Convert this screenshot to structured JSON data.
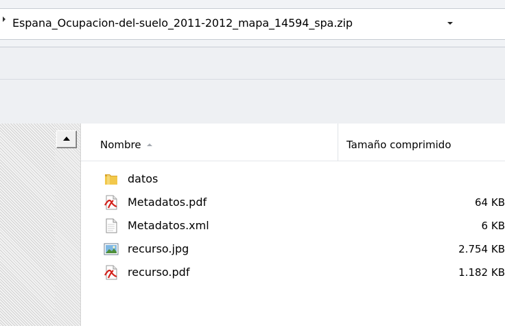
{
  "address": {
    "path_label": "Espana_Ocupacion-del-suelo_2011-2012_mapa_14594_spa.zip"
  },
  "columns": {
    "name": "Nombre",
    "size": "Tamaño comprimido"
  },
  "files": [
    {
      "name": "datos",
      "size": "",
      "icon": "folder-icon"
    },
    {
      "name": "Metadatos.pdf",
      "size": "64 KB",
      "icon": "pdf-icon"
    },
    {
      "name": "Metadatos.xml",
      "size": "6 KB",
      "icon": "document-icon"
    },
    {
      "name": "recurso.jpg",
      "size": "2.754 KB",
      "icon": "image-icon"
    },
    {
      "name": "recurso.pdf",
      "size": "1.182 KB",
      "icon": "pdf-icon"
    }
  ],
  "colors": {
    "folder": "#e8b83a",
    "pdf": "#d4231c",
    "chrome": "#eef0f3"
  }
}
